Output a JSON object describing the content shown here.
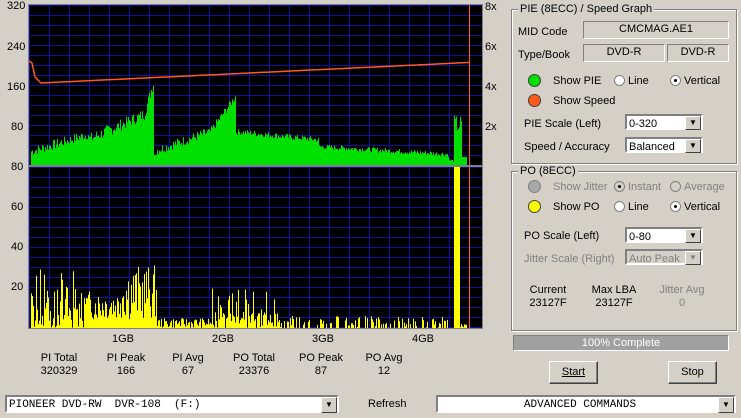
{
  "pie_graph": {
    "left_ticks": [
      "320",
      "240",
      "160",
      "80"
    ],
    "right_ticks": [
      "8x",
      "6x",
      "4x",
      "2x"
    ]
  },
  "po_graph": {
    "left_ticks": [
      "80",
      "60",
      "40",
      "20"
    ],
    "x_ticks": [
      "1GB",
      "2GB",
      "3GB",
      "4GB"
    ]
  },
  "stats": [
    {
      "label": "PI Total",
      "value": "320329"
    },
    {
      "label": "PI Peak",
      "value": "166"
    },
    {
      "label": "PI Avg",
      "value": "67"
    },
    {
      "label": "PO Total",
      "value": "23376"
    },
    {
      "label": "PO Peak",
      "value": "87"
    },
    {
      "label": "PO Avg",
      "value": "12"
    }
  ],
  "pie_panel": {
    "title": "PIE (8ECC) / Speed Graph",
    "mid_label": "MID Code",
    "mid_value": "CMCMAG.AE1",
    "type_label": "Type/Book",
    "type_value": "DVD-R",
    "book_value": "DVD-R",
    "show_pie": "Show PIE",
    "line": "Line",
    "vertical": "Vertical",
    "show_speed": "Show Speed",
    "scale_label": "PIE Scale (Left)",
    "scale_value": "0-320",
    "accuracy_label": "Speed / Accuracy",
    "accuracy_value": "Balanced",
    "pie_color": "#00e000",
    "speed_color": "#ff5a1a"
  },
  "po_panel": {
    "title": "PO (8ECC)",
    "show_jitter": "Show Jitter",
    "instant": "Instant",
    "average": "Average",
    "show_po": "Show PO",
    "line": "Line",
    "vertical": "Vertical",
    "scale_label": "PO Scale (Left)",
    "scale_value": "0-80",
    "jitter_scale_label": "Jitter Scale (Right)",
    "jitter_scale_value": "Auto Peak",
    "current_label": "Current",
    "current_value": "23127F",
    "maxlba_label": "Max LBA",
    "maxlba_value": "23127F",
    "jitteravg_label": "Jitter Avg",
    "jitteravg_value": "0",
    "po_color": "#ffff00"
  },
  "progress": {
    "text": "100% Complete",
    "fraction": 1.0
  },
  "buttons": {
    "start": "Start",
    "stop": "Stop"
  },
  "bottom": {
    "drive": "PIONEER DVD-RW  DVR-108  (F:)",
    "refresh": "Refresh",
    "commands": "ADVANCED COMMANDS"
  }
}
